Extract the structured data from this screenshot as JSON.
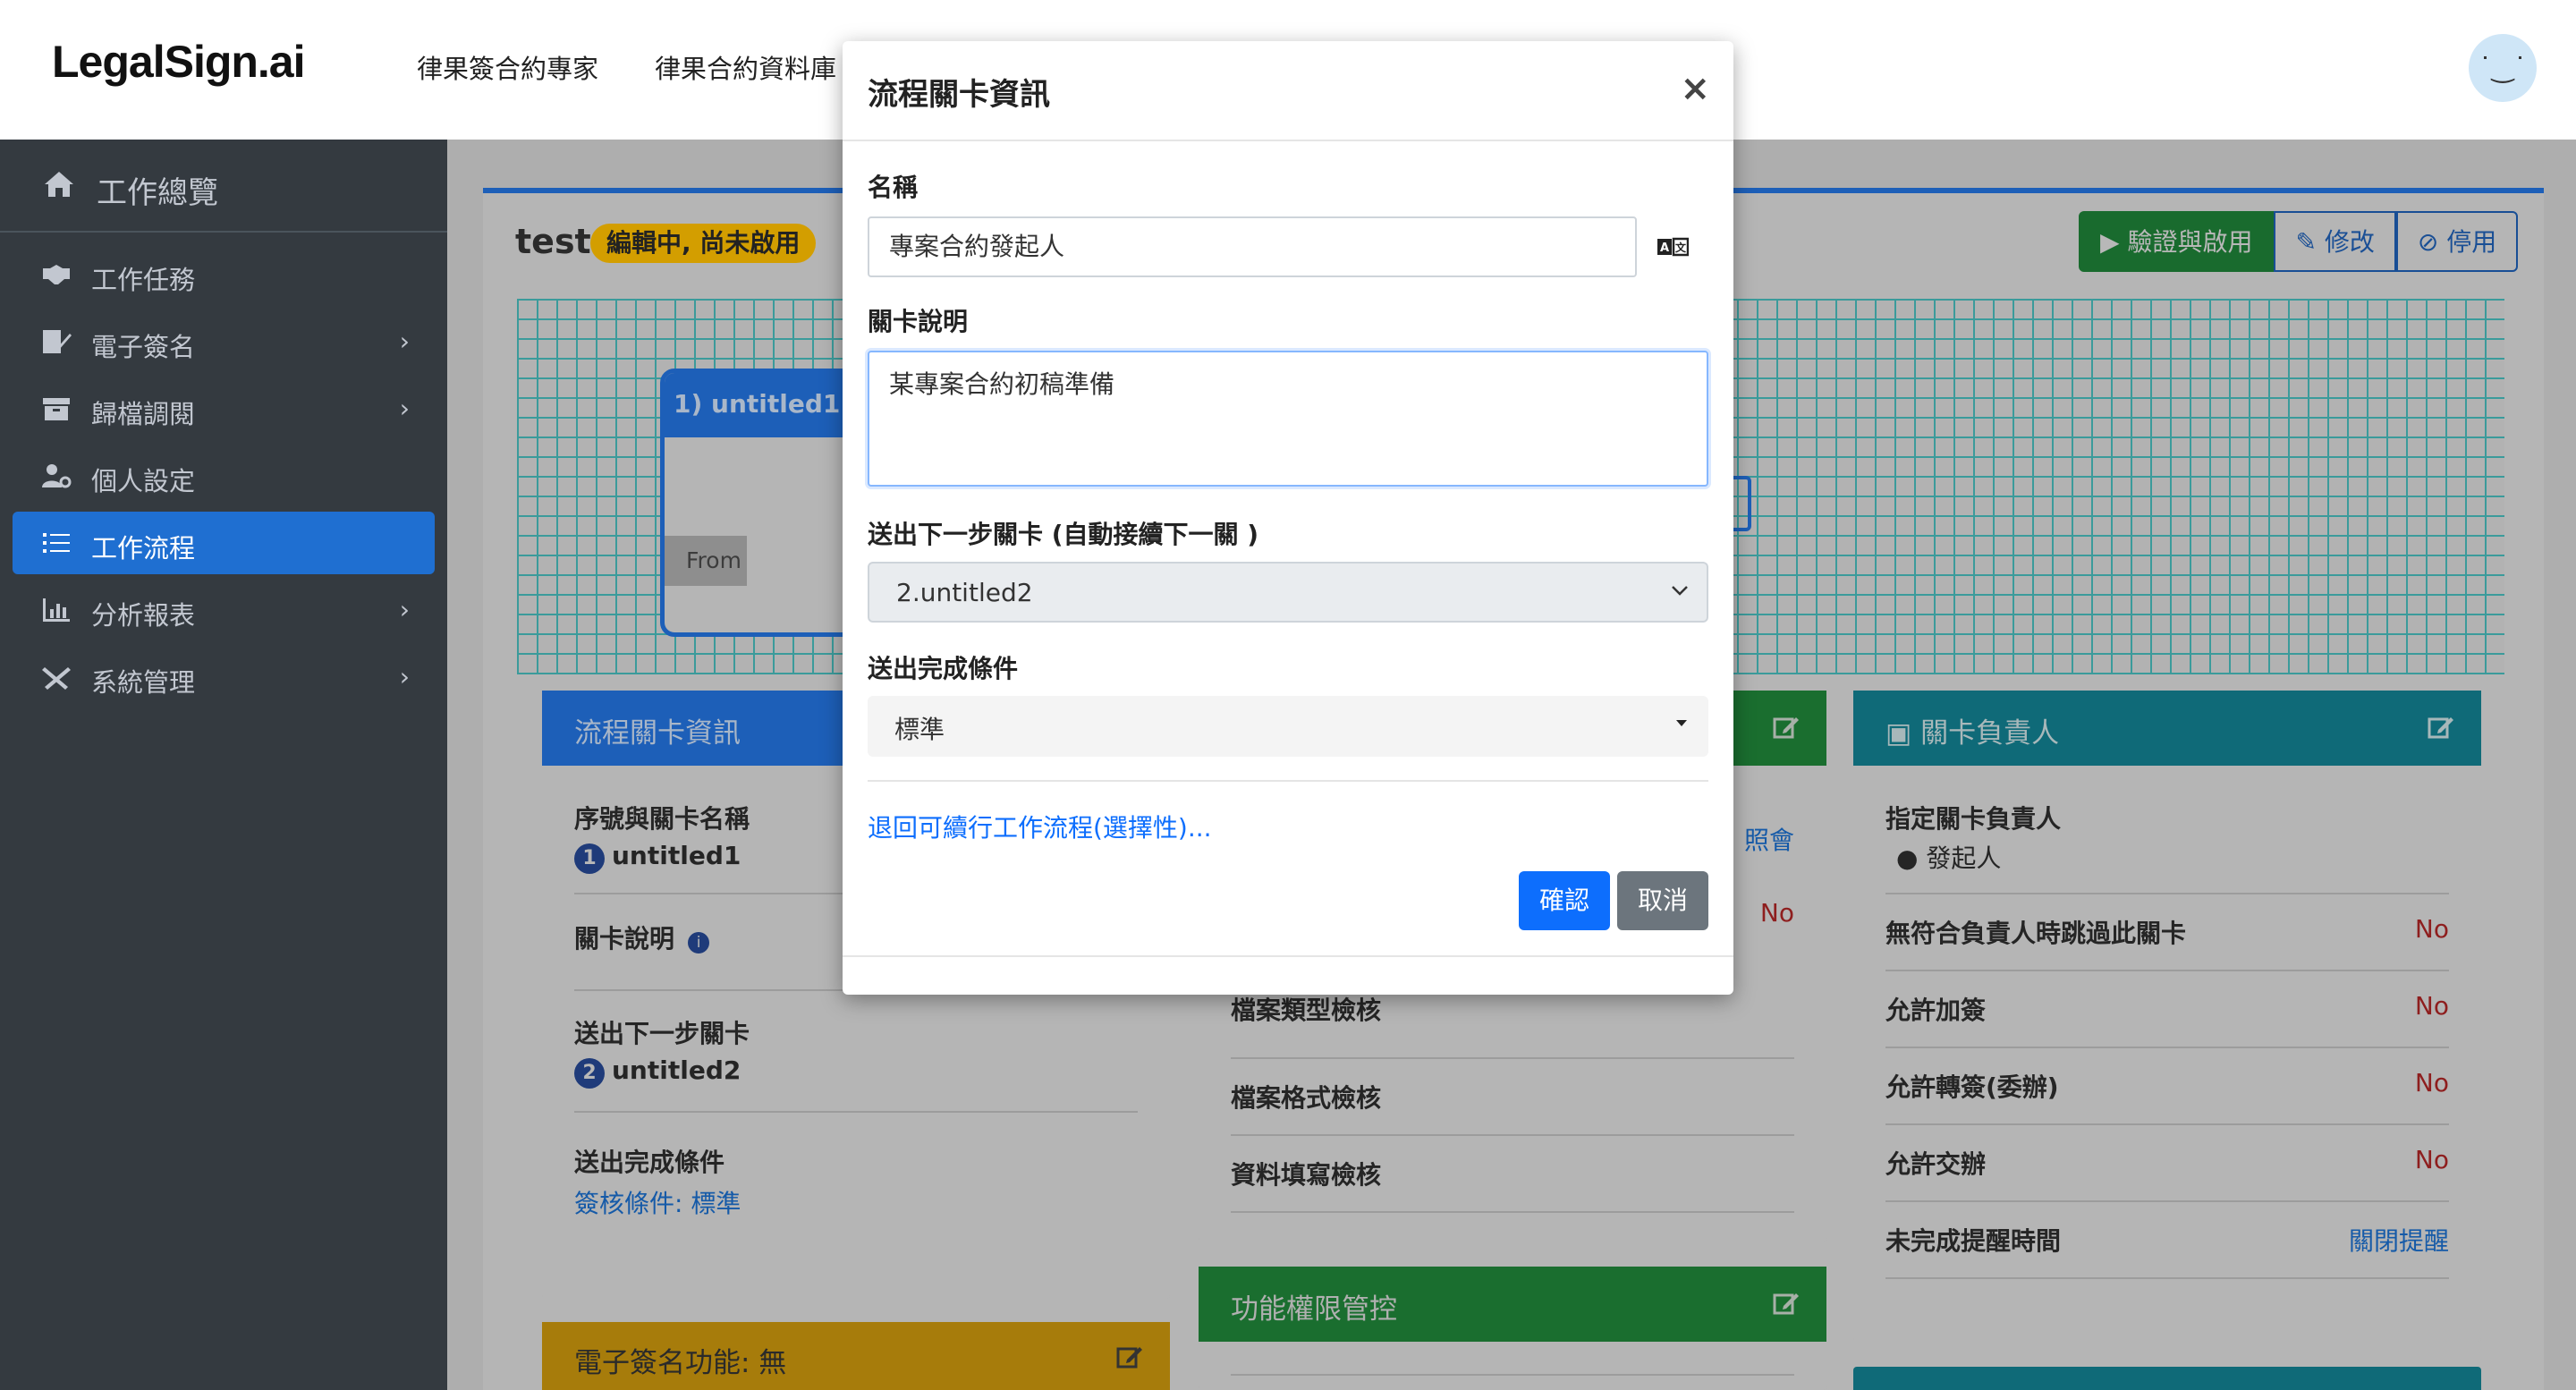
{
  "app": {
    "logo": "LegalSign.ai",
    "nav": [
      "律果簽合約專家",
      "律果合約資料庫"
    ]
  },
  "sidebar": {
    "home": "工作總覽",
    "items": [
      {
        "label": "工作任務",
        "chevron": ""
      },
      {
        "label": "電子簽名",
        "chevron": "›"
      },
      {
        "label": "歸檔調閱",
        "chevron": "›"
      },
      {
        "label": "個人設定",
        "chevron": ""
      },
      {
        "label": "工作流程",
        "chevron": ""
      },
      {
        "label": "分析報表",
        "chevron": "›"
      },
      {
        "label": "系統管理",
        "chevron": "›"
      }
    ]
  },
  "workflow": {
    "name": "test",
    "status": "編輯中, 尚未啟用",
    "buttons": {
      "validate": "驗證與啟用",
      "edit": "修改",
      "disable": "停用"
    },
    "node1": {
      "title": "1) untitled1",
      "from": "From"
    }
  },
  "panel_info": {
    "title": "流程關卡資訊",
    "seq_label": "序號與關卡名稱",
    "seq_num": "1",
    "seq_name": "untitled1",
    "desc_label": "關卡說明",
    "next_label": "送出下一步關卡",
    "next_num": "2",
    "next_name": "untitled2",
    "cond_label": "送出完成條件",
    "cond_value": "簽核條件: 標準"
  },
  "panel_esign": {
    "title": "電子簽名功能: 無"
  },
  "panel_mid": {
    "peek_right": "照會",
    "peek_no": "No",
    "partial_row": "檔案類型檢核",
    "rows": [
      "檔案格式檢核",
      "資料填寫檢核"
    ]
  },
  "panel_perm": {
    "title": "功能權限管控"
  },
  "panel_owner": {
    "title": "關卡負責人",
    "assign_label": "指定關卡負責人",
    "assign_value": "發起人",
    "rows": [
      {
        "label": "無符合負責人時跳過此關卡",
        "value": "No"
      },
      {
        "label": "允許加簽",
        "value": "No"
      },
      {
        "label": "允許轉簽(委辦)",
        "value": "No"
      },
      {
        "label": "允許交辦",
        "value": "No"
      },
      {
        "label": "未完成提醒時間",
        "value": "關閉提醒"
      }
    ]
  },
  "modal": {
    "title": "流程關卡資訊",
    "close": "×",
    "name_label": "名稱",
    "name_value": "專案合約發起人",
    "desc_label": "關卡說明",
    "desc_value": "某專案合約初稿準備",
    "next_label": "送出下一步關卡 (自動接續下一關 )",
    "next_value": "2.untitled2",
    "cond_label": "送出完成條件",
    "cond_value": "標準",
    "link": "退回可續行工作流程(選擇性)...",
    "confirm": "確認",
    "cancel": "取消"
  },
  "colors": {
    "primary": "#0d6efd",
    "sidebar": "#343a40",
    "sidebar_active": "#1f6fd1",
    "warning": "#f0b400",
    "success": "#28a745",
    "teal": "#17a2b8"
  }
}
